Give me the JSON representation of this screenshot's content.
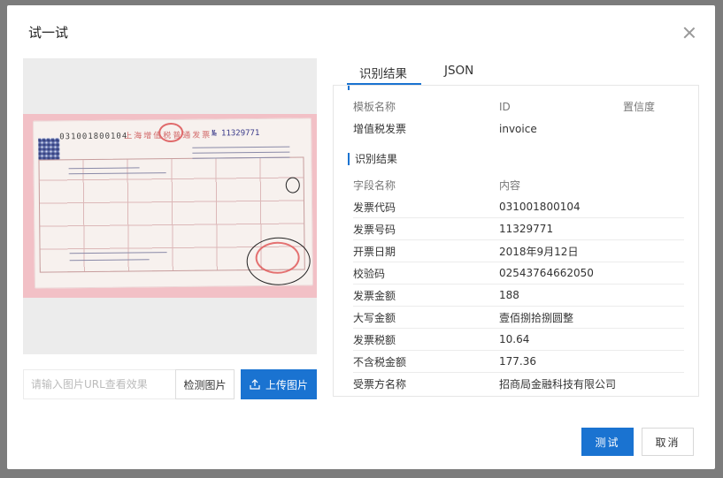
{
  "modal": {
    "title": "试一试"
  },
  "left_panel": {
    "invoice_image": {
      "code_text": "031001800104",
      "title_text": "上海增值税普通发票",
      "number_text": "№ 11329771"
    },
    "url_input_placeholder": "请输入图片URL查看效果",
    "detect_label": "检测图片",
    "upload_label": "上传图片"
  },
  "tabs": [
    {
      "label": "识别结果",
      "active": true
    },
    {
      "label": "JSON",
      "active": false
    }
  ],
  "template_table": {
    "headers": [
      "模板名称",
      "ID",
      "置信度"
    ],
    "row": [
      "增值税发票",
      "invoice",
      ""
    ]
  },
  "results": {
    "title": "识别结果",
    "headers": [
      "字段名称",
      "内容"
    ],
    "rows": [
      [
        "发票代码",
        "031001800104"
      ],
      [
        "发票号码",
        "11329771"
      ],
      [
        "开票日期",
        "2018年9月12日"
      ],
      [
        "校验码",
        "02543764662050"
      ],
      [
        "发票金额",
        "188"
      ],
      [
        "大写金额",
        "壹佰捌拾捌圆整"
      ],
      [
        "发票税额",
        "10.64"
      ],
      [
        "不含税金额",
        "177.36"
      ],
      [
        "受票方名称",
        "招商局金融科技有限公司"
      ]
    ]
  },
  "footer": {
    "ok_label": "测试",
    "cancel_label": "取消"
  },
  "colors": {
    "primary": "#1a73d1",
    "overlay": "#7c7c7c"
  }
}
